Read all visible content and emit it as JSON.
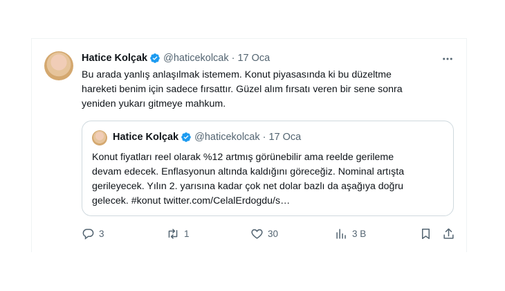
{
  "tweet": {
    "author_name": "Hatice Kolçak",
    "handle": "@haticekolcak",
    "separator": "·",
    "date": "17 Oca",
    "text": "Bu arada yanlış anlaşılmak istemem. Konut piyasasında ki bu düzeltme\nhareketi benim için sadece fırsattır. Güzel alım fırsatı veren bir sene sonra\nyeniden yukarı gitmeye mahkum."
  },
  "quoted_tweet": {
    "author_name": "Hatice Kolçak",
    "handle": "@haticekolcak",
    "separator": "·",
    "date": "17 Oca",
    "text": "Konut fiyatları reel olarak  %12 artmış görünebilir ama reelde gerileme\ndevam edecek. Enflasyonun altında kaldığını göreceğiz. Nominal artışta\ngerileyecek. Yılın 2. yarısına kadar çok net dolar bazlı da aşağıya doğru\ngelecek. #konut twitter.com/CelalErdogdu/s…"
  },
  "actions": {
    "replies": "3",
    "retweets": "1",
    "likes": "30",
    "views": "3 B"
  },
  "colors": {
    "verified_badge": "#1d9bf0",
    "secondary_text": "#536471",
    "border": "#cfd9de"
  },
  "icons": [
    "verified-icon",
    "more-icon",
    "reply-icon",
    "retweet-icon",
    "like-icon",
    "views-icon",
    "bookmark-icon",
    "share-icon"
  ]
}
